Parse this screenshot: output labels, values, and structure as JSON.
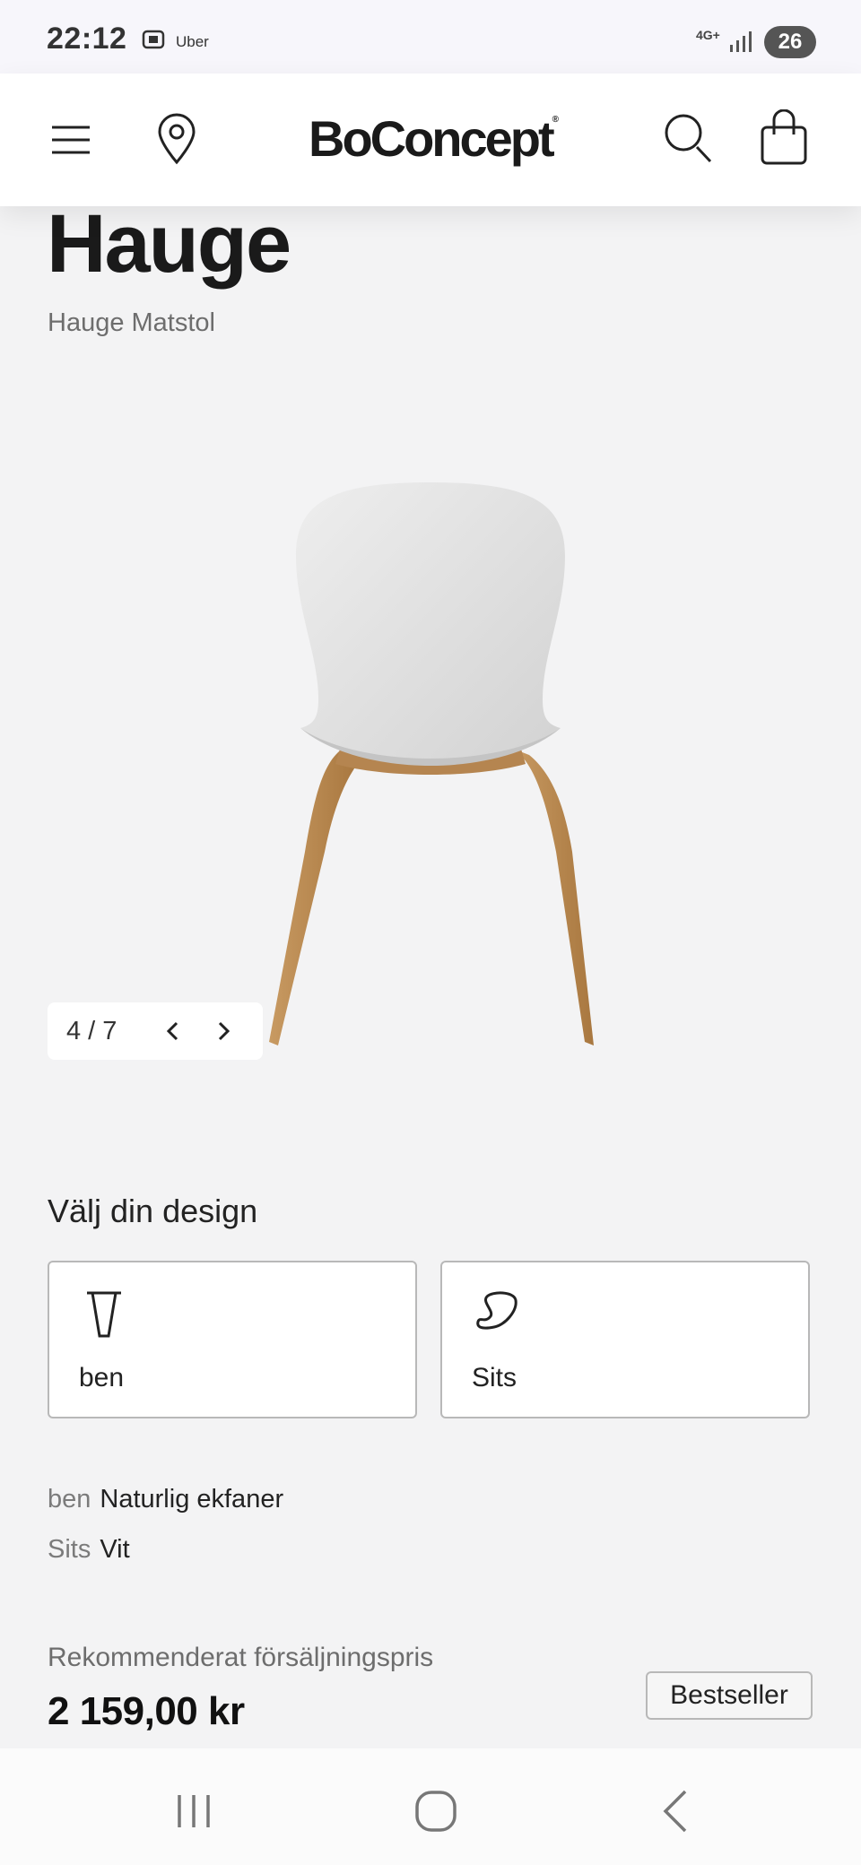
{
  "status_bar": {
    "time": "22:12",
    "app_label": "Uber",
    "network": "4G+",
    "battery": "26"
  },
  "header": {
    "brand": "BoConcept",
    "brand_mark": "®",
    "icons": [
      "menu-icon",
      "location-pin-icon",
      "search-icon",
      "shopping-bag-icon"
    ]
  },
  "product": {
    "title": "Hauge",
    "subtitle": "Hauge Matstol",
    "gallery": {
      "current": 4,
      "total": 7,
      "counter": "4 / 7"
    }
  },
  "design": {
    "heading": "Välj din design",
    "options": [
      {
        "label": "ben",
        "icon": "chair-leg-icon"
      },
      {
        "label": "Sits",
        "icon": "chair-seat-icon"
      }
    ],
    "selections": [
      {
        "key": "ben",
        "value": "Naturlig ekfaner"
      },
      {
        "key": "Sits",
        "value": "Vit"
      }
    ]
  },
  "pricing": {
    "label": "Rekommenderat försäljningspris",
    "price": "2 159,00 kr",
    "badge": "Bestseller"
  },
  "colors": {
    "page_bg": "#f3f3f4",
    "header_bg": "#ffffff",
    "wood": "#b98a56",
    "seat": "#e6e6e6"
  }
}
